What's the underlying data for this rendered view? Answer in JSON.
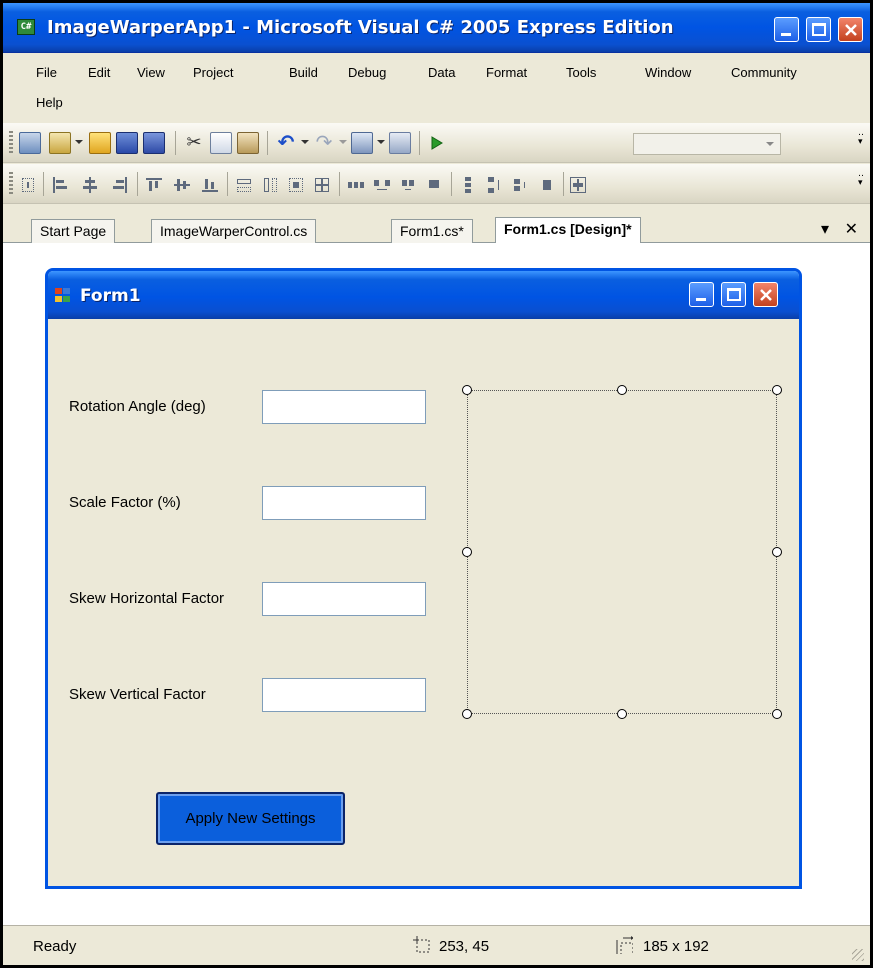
{
  "window": {
    "title": "ImageWarperApp1 - Microsoft Visual C# 2005 Express Edition",
    "icon": "csharp-app-icon"
  },
  "menu": {
    "items": [
      "File",
      "Edit",
      "View",
      "Project",
      "Build",
      "Debug",
      "Data",
      "Format",
      "Tools",
      "Window",
      "Community",
      "Help"
    ]
  },
  "toolbar1": {
    "icons": [
      "new-project-icon",
      "add-item-icon",
      "open-file-icon",
      "save-icon",
      "save-all-icon",
      "cut-icon",
      "copy-icon",
      "paste-icon",
      "undo-icon",
      "redo-icon",
      "navigate-icon",
      "find-icon",
      "start-debug-icon"
    ],
    "solution_config": ""
  },
  "toolbar2": {
    "icons": [
      "align-to-grid-icon",
      "align-lefts-icon",
      "align-centers-icon",
      "align-rights-icon",
      "align-tops-icon",
      "align-middles-icon",
      "align-bottoms-icon",
      "make-same-width-icon",
      "make-same-height-icon",
      "make-same-size-icon",
      "size-to-grid-icon",
      "make-horizontal-spacing-equal-icon",
      "increase-horizontal-spacing-icon",
      "decrease-horizontal-spacing-icon",
      "remove-horizontal-spacing-icon",
      "make-vertical-spacing-equal-icon",
      "increase-vertical-spacing-icon",
      "decrease-vertical-spacing-icon",
      "remove-vertical-spacing-icon",
      "center-horizontally-icon"
    ]
  },
  "tabs": {
    "items": [
      {
        "label": "Start Page",
        "active": false
      },
      {
        "label": "ImageWarperControl.cs",
        "active": false
      },
      {
        "label": "Form1.cs*",
        "active": false
      },
      {
        "label": "Form1.cs [Design]*",
        "active": true
      }
    ],
    "dropdown_glyph": "▾",
    "close_glyph": "✕"
  },
  "form": {
    "title": "Form1",
    "labels": {
      "rotation": "Rotation Angle (deg)",
      "scale": "Scale Factor (%)",
      "skew_h": "Skew Horizontal Factor",
      "skew_v": "Skew Vertical Factor"
    },
    "inputs": {
      "rotation": "",
      "scale": "",
      "skew_h": "",
      "skew_v": ""
    },
    "apply_button": "Apply New Settings"
  },
  "status": {
    "text": "Ready",
    "location": "253, 45",
    "size": "185 x 192"
  },
  "colors": {
    "titlebar": "#0054e3",
    "chrome": "#ece9d8",
    "apply_button": "#0b5fdc"
  }
}
